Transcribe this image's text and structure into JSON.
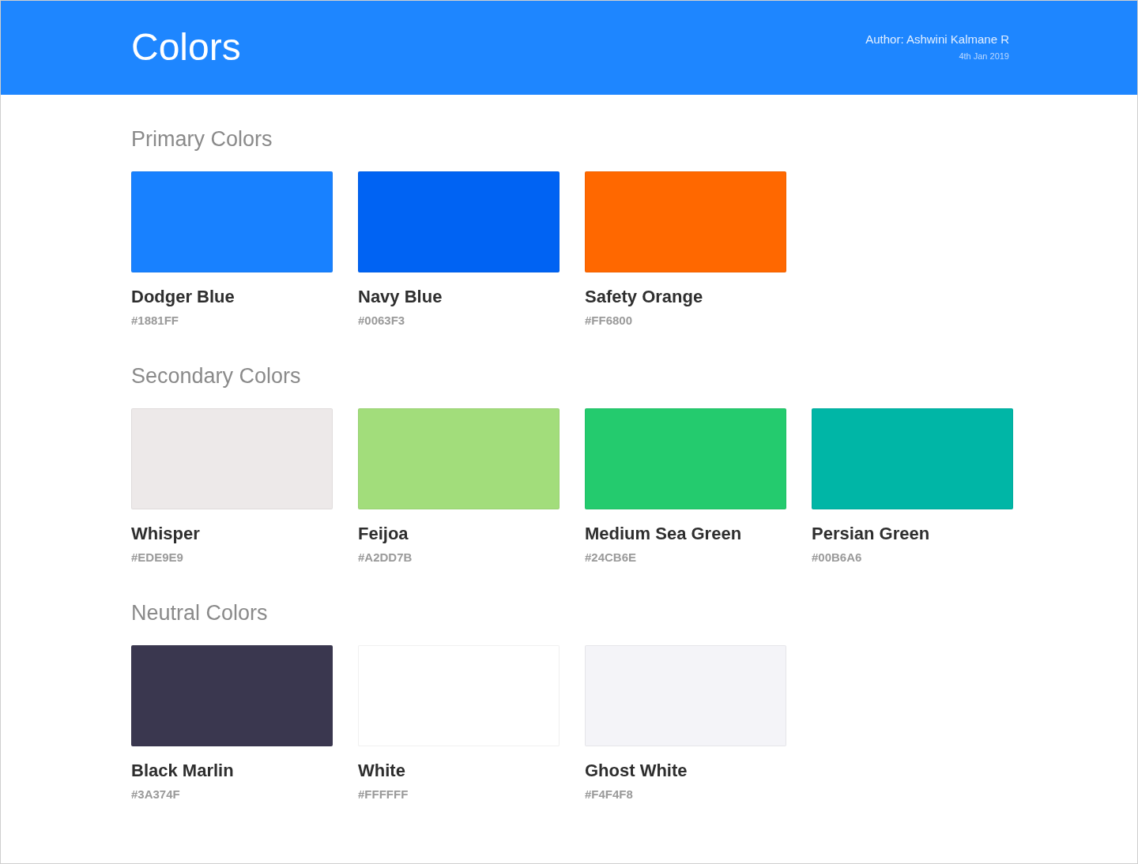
{
  "header": {
    "title": "Colors",
    "author": "Author: Ashwini Kalmane R",
    "date": "4th Jan 2019"
  },
  "sections": [
    {
      "title": "Primary Colors",
      "swatches": [
        {
          "name": "Dodger Blue",
          "hex": "#1881FF",
          "color": "#1881ff"
        },
        {
          "name": "Navy Blue",
          "hex": "#0063F3",
          "color": "#0063f3"
        },
        {
          "name": "Safety Orange",
          "hex": "#FF6800",
          "color": "#ff6800"
        }
      ]
    },
    {
      "title": "Secondary Colors",
      "swatches": [
        {
          "name": "Whisper",
          "hex": "#EDE9E9",
          "color": "#ede9e9"
        },
        {
          "name": "Feijoa",
          "hex": "#A2DD7B",
          "color": "#a2dd7b"
        },
        {
          "name": "Medium Sea Green",
          "hex": "#24CB6E",
          "color": "#24cb6e"
        },
        {
          "name": "Persian Green",
          "hex": "#00B6A6",
          "color": "#00b6a6"
        }
      ]
    },
    {
      "title": "Neutral Colors",
      "swatches": [
        {
          "name": "Black Marlin",
          "hex": "#3A374F",
          "color": "#3a374f"
        },
        {
          "name": "White",
          "hex": "#FFFFFF",
          "color": "#ffffff"
        },
        {
          "name": "Ghost White",
          "hex": "#F4F4F8",
          "color": "#f4f4f8"
        }
      ]
    }
  ]
}
